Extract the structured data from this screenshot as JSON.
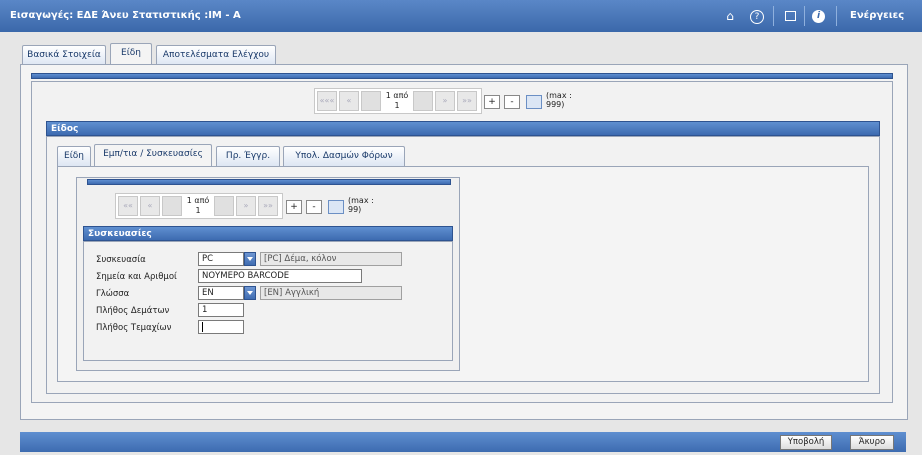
{
  "window": {
    "title": "Εισαγωγές: ΕΔΕ Άνευ Στατιστικής :IM - A",
    "actions_label": "Ενέργειες",
    "icons": [
      "home-icon",
      "help-icon",
      "window-icon",
      "info-icon"
    ]
  },
  "main_tabs": [
    "Βασικά Στοιχεία",
    "Είδη",
    "Αποτελέσματα Ελέγχου"
  ],
  "outer_pager": {
    "first": "«««",
    "prev": "«",
    "current_line1": "1 από",
    "current_line2": "1",
    "next": "»",
    "last": "»»",
    "add": "+",
    "remove": "-",
    "max_line1": "(max :",
    "max_line2": "999)"
  },
  "items_section": {
    "title": "Είδος"
  },
  "item_tabs": [
    "Είδη",
    "Εμπ/τια / Συσκευασίες",
    "Πρ. Έγγρ.",
    "Υπολ. Δασμών Φόρων"
  ],
  "inner_pager": {
    "first": "««",
    "prev": "«",
    "current_line1": "1 από",
    "current_line2": "1",
    "next": "»",
    "last": "»»",
    "add": "+",
    "remove": "-",
    "max_line1": "(max :",
    "max_line2": "99)"
  },
  "packaging": {
    "title": "Συσκευασίες",
    "fields": {
      "package_label": "Συσκευασία",
      "package_value": "PC",
      "package_desc": "[PC] Δέμα, κόλον",
      "marks_label": "Σημεία και Αριθμοί",
      "marks_value": "ΝΟΥΜΕΡΟ BARCODE",
      "language_label": "Γλώσσα",
      "language_value": "EN",
      "language_desc": "[EN] Αγγλική",
      "bundles_label": "Πλήθος Δεμάτων",
      "bundles_value": "1",
      "pieces_label": "Πλήθος Τεμαχίων",
      "pieces_value": ""
    }
  },
  "footer": {
    "submit": "Υποβολή",
    "cancel": "Άκυρο"
  }
}
